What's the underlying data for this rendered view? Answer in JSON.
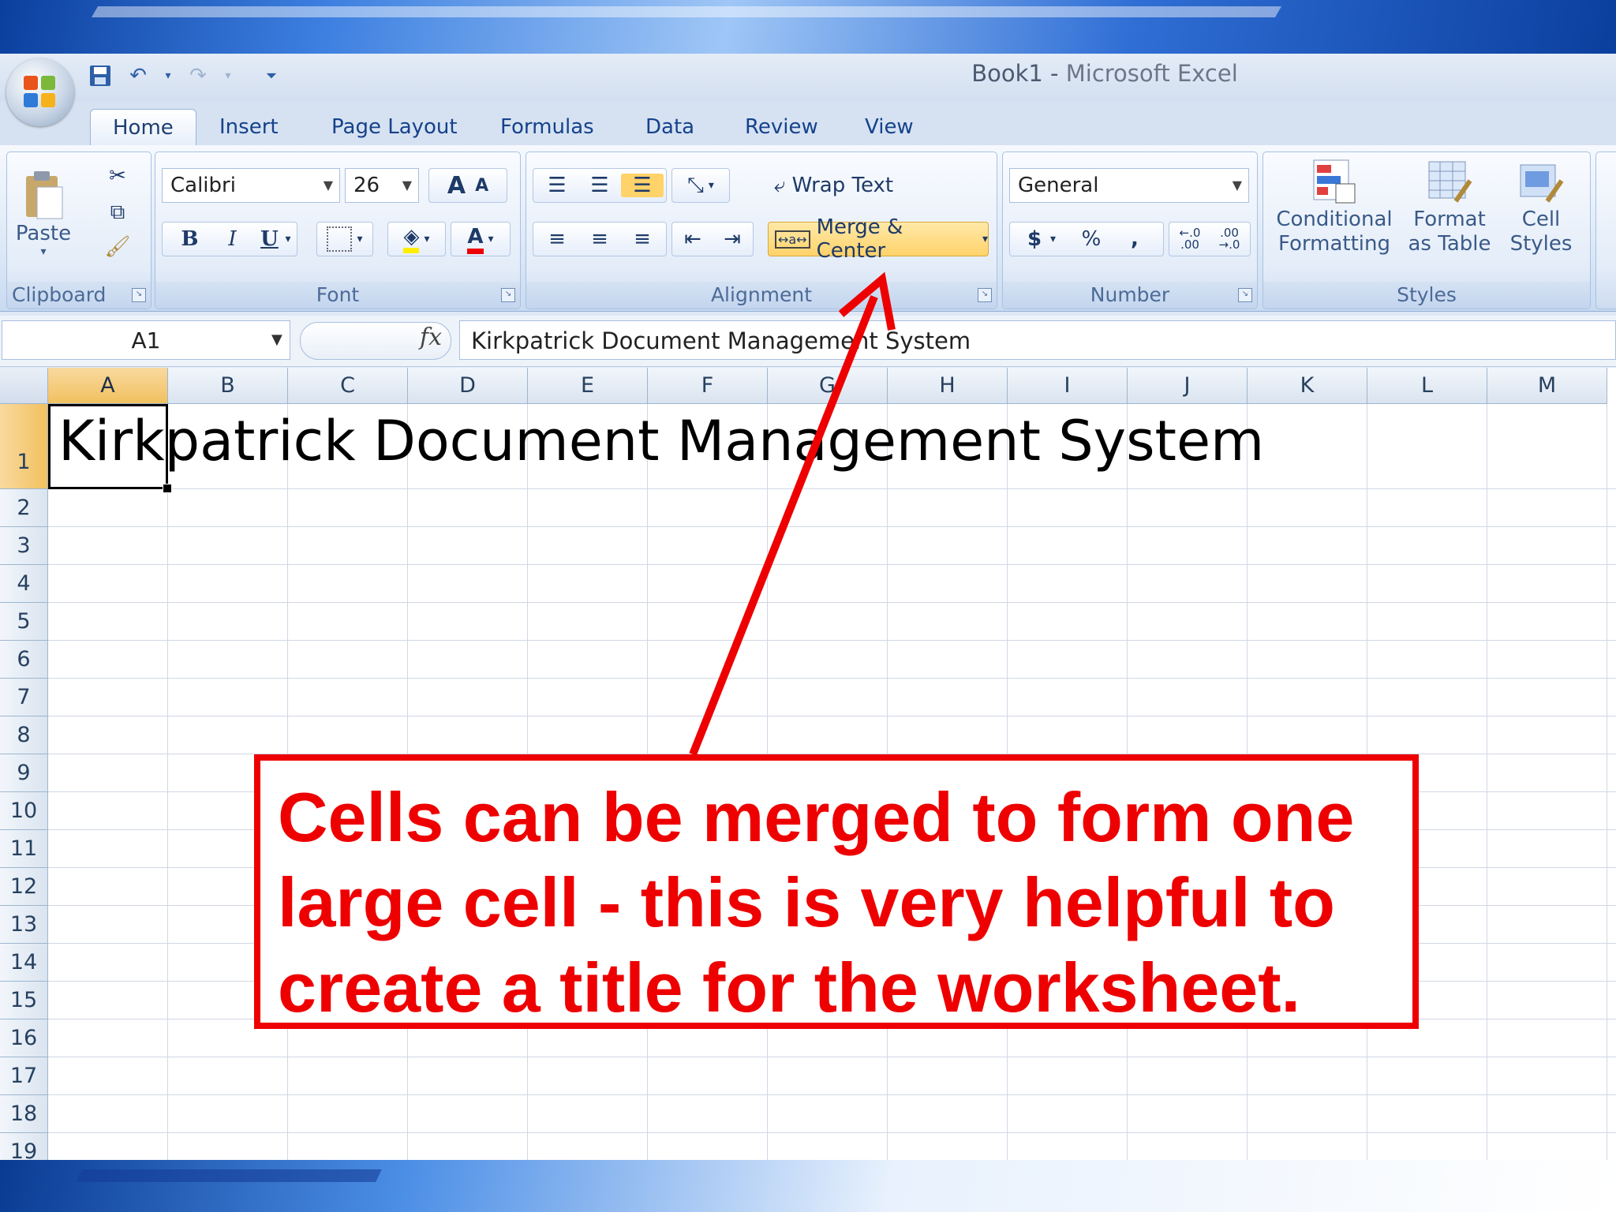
{
  "window": {
    "title_doc": "Book1",
    "title_sep": " - ",
    "title_app": "Microsoft Excel"
  },
  "qat": [
    "save-icon",
    "undo-icon",
    "redo-icon",
    "customize-icon"
  ],
  "tabs": [
    {
      "label": "Home",
      "active": true
    },
    {
      "label": "Insert"
    },
    {
      "label": "Page Layout"
    },
    {
      "label": "Formulas"
    },
    {
      "label": "Data"
    },
    {
      "label": "Review"
    },
    {
      "label": "View"
    }
  ],
  "ribbon": {
    "clipboard": {
      "label": "Clipboard",
      "paste": "Paste"
    },
    "font": {
      "label": "Font",
      "name": "Calibri",
      "size": "26",
      "bold": "B",
      "italic": "I",
      "underline": "U",
      "grow": "A",
      "shrink": "A",
      "color_letter": "A"
    },
    "alignment": {
      "label": "Alignment",
      "wrap_text": "Wrap Text",
      "merge_center": "Merge & Center"
    },
    "number": {
      "label": "Number",
      "format": "General",
      "currency": "$",
      "percent": "%",
      "comma": ",",
      "inc_decimal": "←.0\n.00",
      "dec_decimal": ".00\n→.0"
    },
    "styles": {
      "label": "Styles",
      "conditional_1": "Conditional",
      "conditional_2": "Formatting",
      "table_1": "Format",
      "table_2": "as Table",
      "cell_1": "Cell",
      "cell_2": "Styles"
    }
  },
  "formula_bar": {
    "name_box": "A1",
    "fx": "fx",
    "value": "Kirkpatrick Document Management System"
  },
  "sheet": {
    "columns": [
      "A",
      "B",
      "C",
      "D",
      "E",
      "F",
      "G",
      "H",
      "I",
      "J",
      "K",
      "L",
      "M"
    ],
    "rows": [
      "1",
      "2",
      "3",
      "4",
      "5",
      "6",
      "7",
      "8",
      "9",
      "10",
      "11",
      "12",
      "13",
      "14",
      "15",
      "16",
      "17",
      "18",
      "19"
    ],
    "selected_cell": "A1",
    "a1_value": "Kirkpatrick Document Management System"
  },
  "annotation": {
    "line1": "Cells can be merged to form one",
    "line2": "large cell - this is very helpful to",
    "line3": "create a title for the worksheet.",
    "color": "#ee0000"
  },
  "colors": {
    "ribbon_text": "#15428b",
    "selected_header": "#f1c15f",
    "gridline": "#d0d7e5"
  }
}
